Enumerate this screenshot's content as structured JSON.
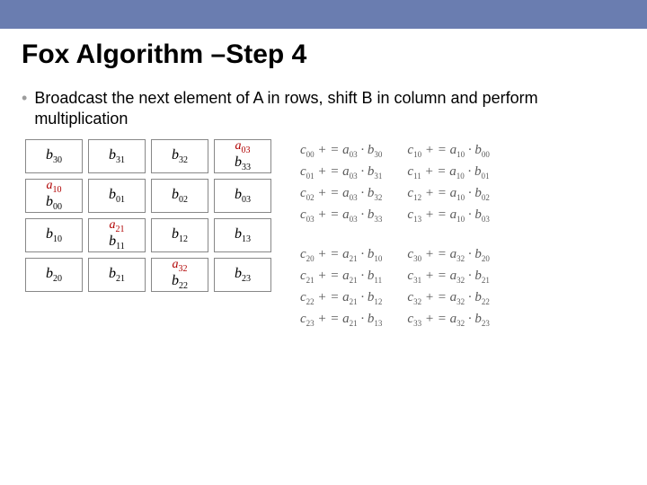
{
  "title": "Fox Algorithm –Step 4",
  "bullet": "Broadcast the next element of A in rows, shift B in column and perform multiplication",
  "grid": [
    [
      {
        "a": null,
        "b": "b_{30}"
      },
      {
        "a": null,
        "b": "b_{31}"
      },
      {
        "a": null,
        "b": "b_{32}"
      },
      {
        "a": "a_{03}",
        "b": "b_{33}"
      }
    ],
    [
      {
        "a": "a_{10}",
        "b": "b_{00}"
      },
      {
        "a": null,
        "b": "b_{01}"
      },
      {
        "a": null,
        "b": "b_{02}"
      },
      {
        "a": null,
        "b": "b_{03}"
      }
    ],
    [
      {
        "a": null,
        "b": "b_{10}"
      },
      {
        "a": "a_{21}",
        "b": "b_{11}"
      },
      {
        "a": null,
        "b": "b_{12}"
      },
      {
        "a": null,
        "b": "b_{13}"
      }
    ],
    [
      {
        "a": null,
        "b": "b_{20}"
      },
      {
        "a": null,
        "b": "b_{21}"
      },
      {
        "a": "a_{32}",
        "b": "b_{22}"
      },
      {
        "a": null,
        "b": "b_{23}"
      }
    ]
  ],
  "equations_top": {
    "left": [
      "c_{00} += a_{03} · b_{30}",
      "c_{01} += a_{03} · b_{31}",
      "c_{02} += a_{03} · b_{32}",
      "c_{03} += a_{03} · b_{33}"
    ],
    "right": [
      "c_{10} += a_{10} · b_{00}",
      "c_{11} += a_{10} · b_{01}",
      "c_{12} += a_{10} · b_{02}",
      "c_{13} += a_{10} · b_{03}"
    ]
  },
  "equations_bottom": {
    "left": [
      "c_{20} += a_{21} · b_{10}",
      "c_{21} += a_{21} · b_{11}",
      "c_{22} += a_{21} · b_{12}",
      "c_{23} += a_{21} · b_{13}"
    ],
    "right": [
      "c_{30} += a_{32} · b_{20}",
      "c_{31} += a_{32} · b_{21}",
      "c_{32} += a_{32} · b_{22}",
      "c_{33} += a_{32} · b_{23}"
    ]
  }
}
